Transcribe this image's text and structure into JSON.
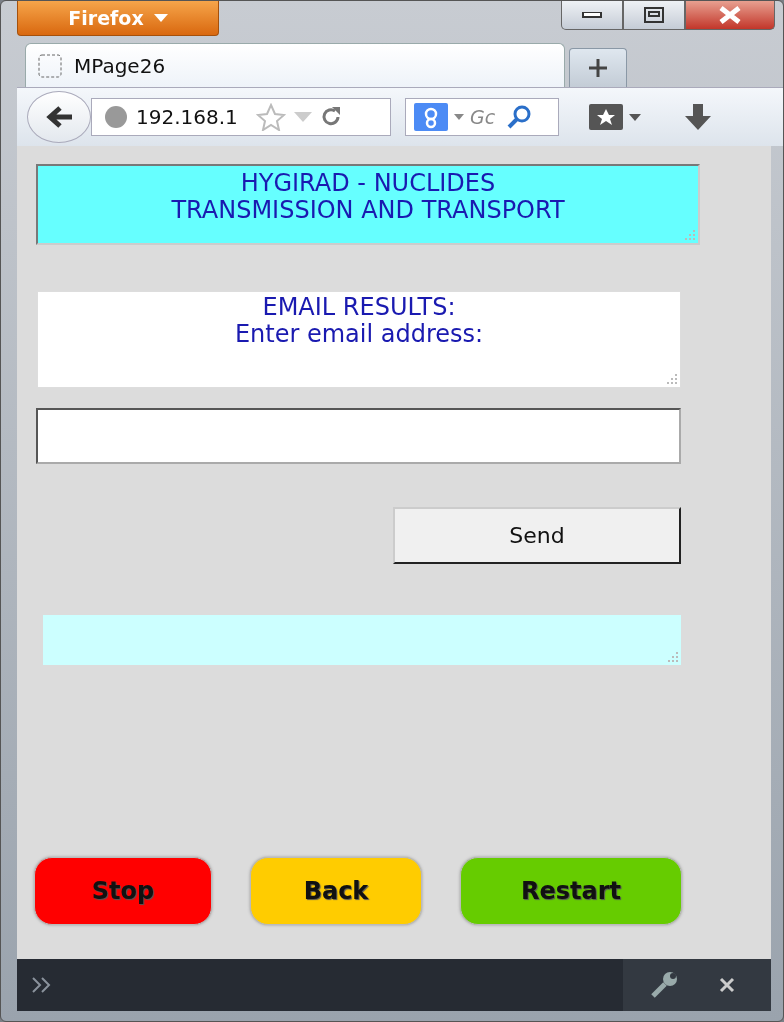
{
  "window": {
    "app_button": "Firefox"
  },
  "tabs": [
    {
      "label": "MPage26",
      "selected": true
    }
  ],
  "toolbar": {
    "address": "192.168.1",
    "search_placeholder": "Gc"
  },
  "page": {
    "header_lines": [
      "HYGIRAD - NUCLIDES",
      "TRANSMISSION AND TRANSPORT"
    ],
    "prompt_lines": [
      "EMAIL RESULTS:",
      "Enter email address:"
    ],
    "send_button": "Send",
    "buttons": [
      {
        "label": "Stop",
        "color": "#ff0000"
      },
      {
        "label": "Back",
        "color": "#ffcc00"
      },
      {
        "label": "Restart",
        "color": "#66cc00"
      }
    ]
  }
}
